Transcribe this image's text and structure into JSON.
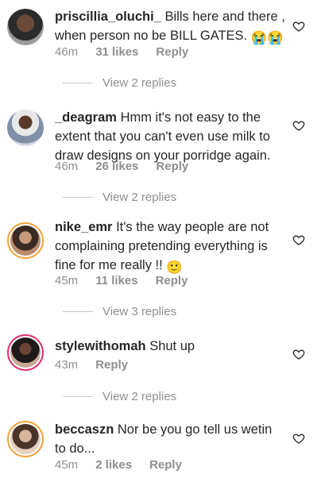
{
  "comments": [
    {
      "username": "priscillia_oluchi_",
      "text": "Bills here and there , when person no be BILL GATES.",
      "emoji": "😭😭",
      "time": "46m",
      "likes": "31 likes",
      "reply": "Reply",
      "view_replies": "View 2 replies"
    },
    {
      "username": "_deagram",
      "text": "Hmm it's not easy to the extent that you can't even use milk to draw designs on your porridge again.",
      "emoji": "",
      "time": "46m",
      "likes": "26 likes",
      "reply": "Reply",
      "view_replies": "View 2 replies"
    },
    {
      "username": "nike_emr",
      "text": "It's the way people are not complaining pretending everything is fine for me really !!",
      "emoji": "🙂",
      "time": "45m",
      "likes": "11 likes",
      "reply": "Reply",
      "view_replies": "View 3 replies"
    },
    {
      "username": "stylewithomah",
      "text": "Shut up",
      "emoji": "",
      "time": "43m",
      "likes": "",
      "reply": "Reply",
      "view_replies": "View 2 replies"
    },
    {
      "username": "beccaszn",
      "text": "Nor be you go tell us wetin to do...",
      "emoji": "",
      "time": "45m",
      "likes": "2 likes",
      "reply": "Reply",
      "view_replies": ""
    }
  ],
  "colors": {
    "username": "#262626",
    "meta": "#8e8e8e",
    "story_ring_orange": "#f2a33a",
    "story_ring_pink": "#e1306c"
  },
  "icons": {
    "like": "heart-outline-icon"
  }
}
